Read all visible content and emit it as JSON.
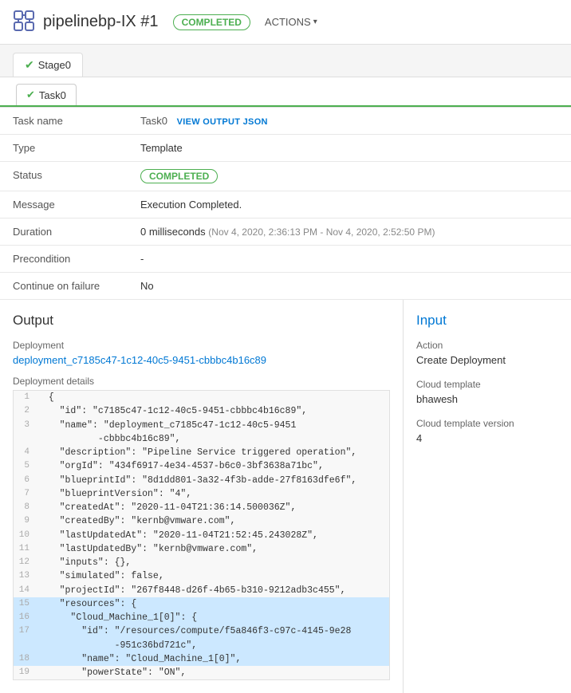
{
  "header": {
    "icon_label": "pipeline-icon",
    "title": "pipelinebp-IX #1",
    "status_badge": "COMPLETED",
    "actions_label": "ACTIONS"
  },
  "stage_tab": {
    "label": "Stage0",
    "check": "✔"
  },
  "task_tab": {
    "label": "Task0",
    "check": "✔"
  },
  "details": {
    "task_name_label": "Task name",
    "task_name_value": "Task0",
    "view_output_label": "VIEW OUTPUT JSON",
    "type_label": "Type",
    "type_value": "Template",
    "status_label": "Status",
    "status_value": "COMPLETED",
    "message_label": "Message",
    "message_value": "Execution Completed.",
    "duration_label": "Duration",
    "duration_value": "0 milliseconds",
    "duration_note": "(Nov 4, 2020, 2:36:13 PM - Nov 4, 2020, 2:52:50 PM)",
    "precondition_label": "Precondition",
    "precondition_value": "-",
    "continue_on_failure_label": "Continue on failure",
    "continue_on_failure_value": "No"
  },
  "output": {
    "section_title": "Output",
    "deployment_label": "Deployment",
    "deployment_link": "deployment_c7185c47-1c12-40c5-9451-cbbbc4b16c89",
    "deployment_details_label": "Deployment details",
    "json_lines": [
      {
        "num": "1",
        "content": "  {",
        "highlight": false
      },
      {
        "num": "2",
        "content": "    \"id\": \"c7185c47-1c12-40c5-9451-cbbbc4b16c89\",",
        "highlight": false
      },
      {
        "num": "3",
        "content": "    \"name\": \"deployment_c7185c47-1c12-40c5-9451\n           -cbbbc4b16c89\",",
        "highlight": false
      },
      {
        "num": "4",
        "content": "    \"description\": \"Pipeline Service triggered operation\",",
        "highlight": false
      },
      {
        "num": "5",
        "content": "    \"orgId\": \"434f6917-4e34-4537-b6c0-3bf3638a71bc\",",
        "highlight": false
      },
      {
        "num": "6",
        "content": "    \"blueprintId\": \"8d1dd801-3a32-4f3b-adde-27f8163dfe6f\",",
        "highlight": false
      },
      {
        "num": "7",
        "content": "    \"blueprintVersion\": \"4\",",
        "highlight": false
      },
      {
        "num": "8",
        "content": "    \"createdAt\": \"2020-11-04T21:36:14.500036Z\",",
        "highlight": false
      },
      {
        "num": "9",
        "content": "    \"createdBy\": \"kernb@vmware.com\",",
        "highlight": false
      },
      {
        "num": "10",
        "content": "    \"lastUpdatedAt\": \"2020-11-04T21:52:45.243028Z\",",
        "highlight": false
      },
      {
        "num": "11",
        "content": "    \"lastUpdatedBy\": \"kernb@vmware.com\",",
        "highlight": false
      },
      {
        "num": "12",
        "content": "    \"inputs\": {},",
        "highlight": false
      },
      {
        "num": "13",
        "content": "    \"simulated\": false,",
        "highlight": false
      },
      {
        "num": "14",
        "content": "    \"projectId\": \"267f8448-d26f-4b65-b310-9212adb3c455\",",
        "highlight": false
      },
      {
        "num": "15",
        "content": "    \"resources\": {",
        "highlight": true
      },
      {
        "num": "16",
        "content": "      \"Cloud_Machine_1[0]\": {",
        "highlight": true
      },
      {
        "num": "17",
        "content": "        \"id\": \"/resources/compute/f5a846f3-c97c-4145-9e28\n              -951c36bd721c\",",
        "highlight": true
      },
      {
        "num": "18",
        "content": "        \"name\": \"Cloud_Machine_1[0]\",",
        "highlight": true
      },
      {
        "num": "19",
        "content": "        \"powerState\": \"ON\",",
        "highlight": false
      }
    ]
  },
  "input": {
    "section_title": "Input",
    "action_label": "Action",
    "action_value": "Create Deployment",
    "cloud_template_label": "Cloud template",
    "cloud_template_value": "bhawesh",
    "cloud_template_version_label": "Cloud template version",
    "cloud_template_version_value": "4"
  }
}
